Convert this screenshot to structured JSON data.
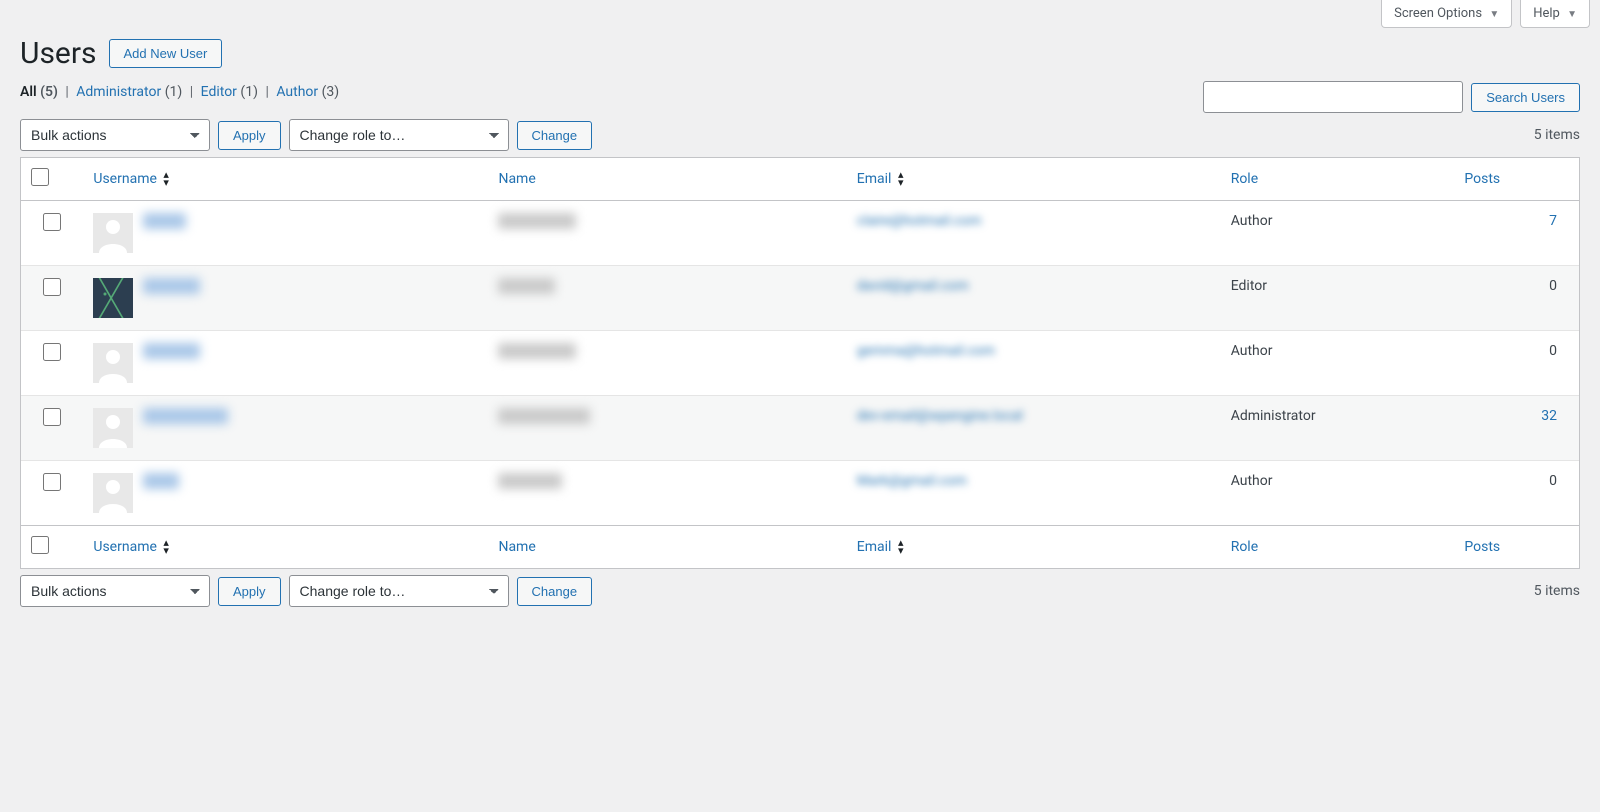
{
  "screenTabs": {
    "options": "Screen Options",
    "help": "Help"
  },
  "page": {
    "title": "Users",
    "addNew": "Add New User"
  },
  "filters": {
    "all": "All",
    "allCount": "(5)",
    "admin": "Administrator",
    "adminCount": "(1)",
    "editor": "Editor",
    "editorCount": "(1)",
    "author": "Author",
    "authorCount": "(3)"
  },
  "search": {
    "button": "Search Users"
  },
  "bulk": {
    "bulkActions": "Bulk actions",
    "apply": "Apply",
    "changeRole": "Change role to…",
    "change": "Change"
  },
  "itemsCount": "5 items",
  "columns": {
    "username": "Username",
    "name": "Name",
    "email": "Email",
    "role": "Role",
    "posts": "Posts"
  },
  "rows": [
    {
      "avatar": "default",
      "usernameMask": "xxxxx",
      "nameMask": "xxxxxxxxxx",
      "email": "claire@hotmail.com",
      "role": "Author",
      "posts": "7",
      "postsLink": true
    },
    {
      "avatar": "branch",
      "usernameMask": "xxxxxxx",
      "nameMask": "xxxxxxx",
      "email": "david@gmail.com",
      "role": "Editor",
      "posts": "0",
      "postsLink": false
    },
    {
      "avatar": "default",
      "usernameMask": "xxxxxxx",
      "nameMask": "xxxxxxxxxx",
      "email": "gemma@hotmail.com",
      "role": "Author",
      "posts": "0",
      "postsLink": false
    },
    {
      "avatar": "default",
      "usernameMask": "xxxxxxxxxxx",
      "nameMask": "xxxxxxxxxxxx",
      "email": "dev-email@wpengine.local",
      "role": "Administrator",
      "posts": "32",
      "postsLink": true
    },
    {
      "avatar": "default",
      "usernameMask": "xxxx",
      "nameMask": "xxxxxxxx",
      "email": "Mark@gmail.com",
      "role": "Author",
      "posts": "0",
      "postsLink": false
    }
  ]
}
